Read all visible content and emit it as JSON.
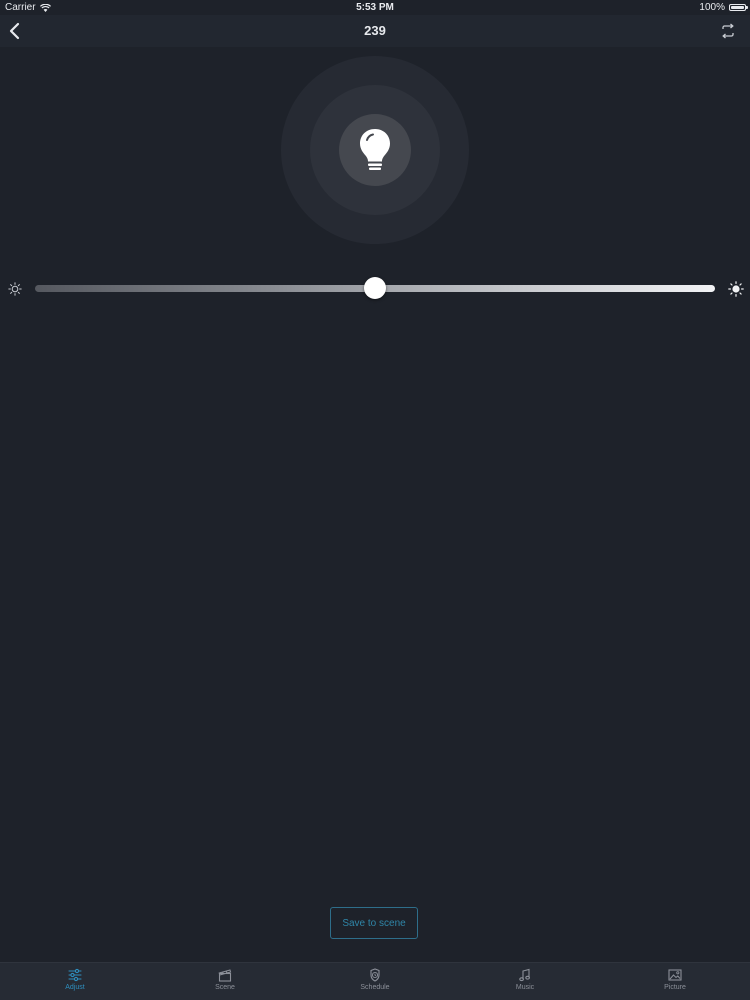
{
  "status_bar": {
    "carrier": "Carrier",
    "time": "5:53 PM",
    "battery": "100%"
  },
  "nav": {
    "title": "239"
  },
  "brightness": {
    "level_fraction": 0.5
  },
  "actions": {
    "save_label": "Save to scene"
  },
  "tabs": [
    {
      "label": "Adjust",
      "icon": "sliders-icon",
      "active": true
    },
    {
      "label": "Scene",
      "icon": "clapperboard-icon",
      "active": false
    },
    {
      "label": "Schedule",
      "icon": "clock-icon",
      "active": false
    },
    {
      "label": "Music",
      "icon": "music-note-icon",
      "active": false
    },
    {
      "label": "Picture",
      "icon": "picture-icon",
      "active": false
    }
  ],
  "colors": {
    "background": "#1e222a",
    "accent": "#2f8fbf",
    "bulb": "#ffffff"
  }
}
